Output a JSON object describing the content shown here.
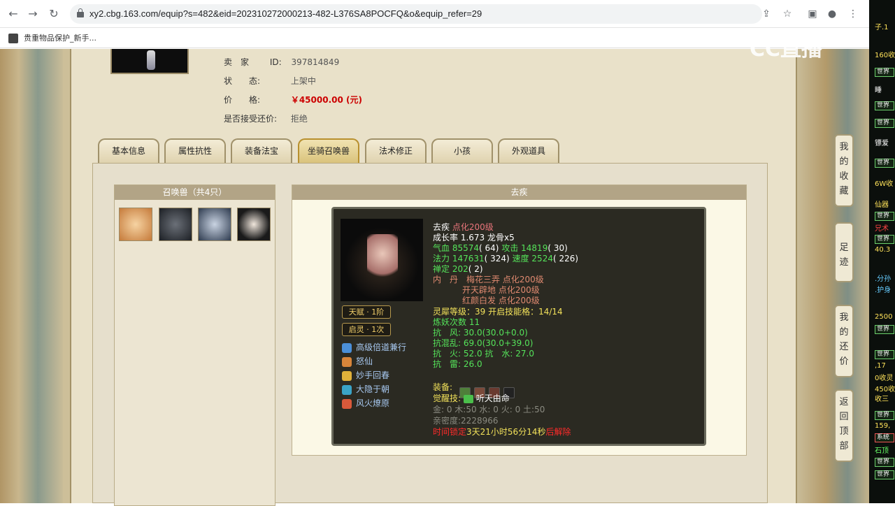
{
  "browser": {
    "url": "xy2.cbg.163.com/equip?s=482&eid=202310272000213-482-L376SA8POCFQ&o&equip_refer=29",
    "bookmark": "贵重物品保护_新手..."
  },
  "seller": {
    "seller_label": "卖　家",
    "seller_id_label": "ID:",
    "seller_id": "397814849",
    "status_label": "状　　态:",
    "status_value": "上架中",
    "price_label": "价　　格:",
    "price_value": "￥45000.00 (元)",
    "counter_label": "是否接受还价:",
    "counter_value": "拒绝"
  },
  "tabs": [
    "基本信息",
    "属性抗性",
    "装备法宝",
    "坐骑召唤兽",
    "法术修正",
    "小孩",
    "外观道具"
  ],
  "active_tab": "坐骑召唤兽",
  "summon_list": {
    "title": "召唤兽（共4只）",
    "count": 4
  },
  "detail": {
    "title": "去疾",
    "name": "去疾",
    "level": "点化200级",
    "growth": "成长率 1.673 龙骨x5",
    "hp_label": "气血",
    "hp": "85574",
    "hp_extra": "( 64)",
    "atk_label": "攻击",
    "atk": "14819",
    "atk_extra": "( 30)",
    "mp_label": "法力",
    "mp": "147631",
    "mp_extra": "( 324)",
    "spd_label": "速度",
    "spd": "2524",
    "spd_extra": "( 226)",
    "zen_label": "禅定",
    "zen": "202",
    "zen_extra": "( 2)",
    "neidan_label": "内　丹",
    "neidan": [
      {
        "name": "梅花三弄",
        "level": "点化200级"
      },
      {
        "name": "开天辟地",
        "level": "点化200级"
      },
      {
        "name": "红颜白发",
        "level": "点化200级"
      }
    ],
    "spirit_line": "灵犀等级：39 开启技能格：14/14",
    "refine": "炼妖次数 11",
    "res_wind": "抗　风: 30.0(30.0+0.0)",
    "res_chaos": "抗混乱: 69.0(30.0+39.0)",
    "res_fire_water": "抗　火: 52.0 抗　水: 27.0",
    "res_thunder": "抗　雷: 26.0",
    "equip_label": "装备:",
    "awaken_label": "觉醒技:",
    "awaken_skill": "听天由命",
    "elements": "金: 0 木:50 水: 0 火: 0 土:50",
    "intimacy": "亲密度:2228966",
    "timelock_prefix": "时间锁定",
    "timelock_time": "3天21小时56分14秒",
    "timelock_suffix": "后解除",
    "badge_talent": "天赋 · 1阶",
    "badge_qiling": "启灵 · 1次",
    "skills": [
      "高级倍道兼行",
      "怒仙",
      "妙手回春",
      "大隐于朝",
      "风火燎原"
    ]
  },
  "side_buttons": [
    {
      "label": "我的收藏",
      "chars": [
        "我",
        "的",
        "收",
        "藏"
      ]
    },
    {
      "label": "足迹",
      "chars": [
        "足",
        "迹"
      ]
    },
    {
      "label": "我的还价",
      "chars": [
        "我",
        "的",
        "还",
        "价"
      ]
    },
    {
      "label": "返回顶部",
      "chars": [
        "返",
        "回",
        "顶",
        "部"
      ]
    }
  ],
  "watermark": "CC直播",
  "chat": [
    "子.1",
    "160收",
    "世界",
    "睡",
    "世界",
    "世界",
    "镖爱",
    "世界",
    "6W收",
    "仙器",
    "世界",
    "兄术",
    "世界",
    "40.3",
    ".分孙",
    ".护身",
    "2500",
    "世界",
    "世界",
    ",17",
    "0收灵",
    "450收",
    "收三",
    "世界",
    "159,",
    "系统",
    "石顶",
    "世界",
    "世界"
  ]
}
